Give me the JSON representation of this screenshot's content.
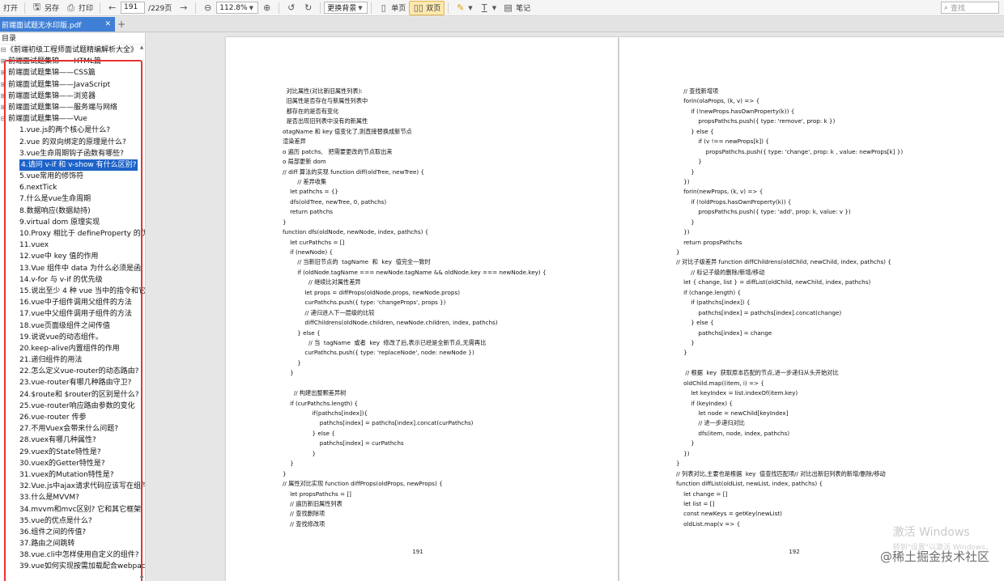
{
  "toolbar": {
    "open": "打开",
    "save_as": "另存",
    "print": "打印",
    "page_input": "191",
    "page_total": "/229页",
    "zoom": "112.8%",
    "background": "更换背景",
    "single": "单页",
    "double": "双页",
    "note": "笔记",
    "search_placeholder": "查找"
  },
  "tab": {
    "title": "前端面试题无水印版.pdf"
  },
  "sidebar": {
    "header": "目录",
    "root": "《前端初级工程师面试题精编解析大全》",
    "sections": [
      "前端面试题集锦——HTML篇",
      "前端面试题集锦——CSS篇",
      "前端面试题集锦——JavaScript",
      "前端面试题集锦——浏览器",
      "前端面试题集锦——服务端与网络",
      "前端面试题集锦——Vue"
    ],
    "items": [
      "1.vue.js的两个核心是什么?",
      "2.vue 的双向绑定的原理是什么?",
      "3.vue生命周期钩子函数有哪些?",
      "4.请问 v-if 和 v-show 有什么区别?",
      "5.vue常用的修饰符",
      "6.nextTick",
      "7.什么是vue生命周期",
      "8.数据响应(数据劫持)",
      "9.virtual dom 原理实现",
      "10.Proxy 相比于 defineProperty 的优",
      "11.vuex",
      "12.vue中 key 值的作用",
      "13.Vue 组件中 data 为什么必须是函",
      "14.v-for 与 v-if 的优先级",
      "15.说出至少 4 种 vue 当中的指令和它",
      "16.vue中子组件调用父组件的方法",
      "17.vue中父组件调用子组件的方法",
      "18.vue页面级组件之间传值",
      "19.说说vue的动态组件。",
      "20.keep-alive内置组件的作用",
      "21.递归组件的用法",
      "22.怎么定义vue-router的动态路由?",
      "23.vue-router有哪几种路由守卫?",
      "24.$route和 $router的区别是什么?",
      "25.vue-router响应路由参数的变化",
      "26.vue-router 传参",
      "27.不用Vuex会带来什么问题?",
      "28.vuex有哪几种属性?",
      "29.vuex的State特性是?",
      "30.vuex的Getter特性是?",
      "31.vuex的Mutation特性是?",
      "32.Vue.js中ajax请求代码应该写在组件",
      "33.什么是MVVM?",
      "34.mvvm和mvc区别? 它和其它框架",
      "35.vue的优点是什么?",
      "36.组件之间的传值?",
      "37.路由之间跳转",
      "38.vue.cli中怎样使用自定义的组件?",
      "39.vue如何实现按需加载配合webpac"
    ]
  },
  "page_left": {
    "lines": [
      "  对比属性(对比新旧属性列表):",
      "  旧属性是否存在与新属性列表中",
      "  都存在的是否有变化",
      "  是否出现旧列表中没有的新属性",
      "otagName 和 key 值变化了,则直接替换成新节点",
      "渲染差异",
      "o 遍历 patchs,   把需要更改的节点取出来",
      "o 局部更新 dom",
      "// diff 算法的实现 function diff(oldTree, newTree) {",
      "        // 差异收集",
      "    let pathchs = {}",
      "    dfs(oldTree, newTree, 0, pathchs)",
      "    return pathchs",
      "}",
      "function dfs(oldNode, newNode, index, pathchs) {",
      "    let curPathchs = []",
      "    if (newNode) {",
      "        // 当新旧节点的  tagName  和  key  值完全一致时",
      "        if (oldNode.tagName === newNode.tagName && oldNode.key === newNode.key) {",
      "              // 继续比对属性差异",
      "            let props = diffProps(oldNode.props, newNode.props)",
      "            curPathchs.push({ type: 'changeProps', props })",
      "            // 递归进入下一层级的比较",
      "            diffChildrens(oldNode.children, newNode.children, index, pathchs)",
      "        } else {",
      "              // 当  tagName  或者  key  修改了后,表示已经是全新节点,无需再比",
      "            curPathchs.push({ type: 'replaceNode', node: newNode })",
      "        }",
      "    }",
      "",
      "      // 构建出整颗差异树",
      "    if (curPathchs.length) {",
      "                if(pathchs[index]){",
      "                    pathchs[index] = pathchs[index].concat(curPathchs)",
      "                } else {",
      "                    pathchs[index] = curPathchs",
      "                }",
      "    }",
      "}",
      "// 属性对比实现 function diffProps(oldProps, newProps) {",
      "    let propsPathchs = []",
      "    // 遍历新旧属性列表",
      "    // 查找删除项",
      "    // 查找修改项"
    ],
    "page_number": "191"
  },
  "page_right": {
    "lines": [
      "    // 查找新增项",
      "    forin(olaProps, (k, v) => {",
      "        if (!newProps.hasOwnProperty(k)) {",
      "            propsPathchs.push({ type: 'remove', prop: k })",
      "        } else {",
      "            if (v !== newProps[k]) {",
      "                propsPathchs.push({ type: 'change', prop: k , value: newProps[k] })",
      "            }",
      "        }",
      "    })",
      "    forin(newProps, (k, v) => {",
      "        if (!oldProps.hasOwnProperty(k)) {",
      "            propsPathchs.push({ type: 'add', prop: k, value: v })",
      "        }",
      "    })",
      "    return propsPathchs",
      "}",
      "// 对比子级差异 function diffChildrens(oldChild, newChild, index, pathchs) {",
      "        // 标记子级的删除/新增/移动",
      "    let { change, list } = diffList(oldChild, newChild, index, pathchs)",
      "    if (change.length) {",
      "        if (pathchs[index]) {",
      "            pathchs[index] = pathchs[index].concat(change)",
      "        } else {",
      "            pathchs[index] = change",
      "        }",
      "    }",
      "",
      "     // 根据  key  获取原本匹配的节点,进一步递归从头开始对比",
      "    oldChild.map((item, i) => {",
      "        let keyIndex = list.indexOf(item.key)",
      "        if (keyIndex) {",
      "            let node = newChild[keyIndex]",
      "            // 进一步递归对比",
      "            dfs(item, node, index, pathchs)",
      "        }",
      "    })",
      "}",
      "// 列表对比,主要也是根据  key  值查找匹配项// 对比出新旧列表的新增/删除/移动",
      "function diffList(oldList, newList, index, pathchs) {",
      "    let change = []",
      "    let list = []",
      "    const newKeys = getKey(newList)",
      "    oldList.map(v => {"
    ],
    "page_number": "192"
  },
  "watermark": {
    "title": "激活 Windows",
    "subtitle": "转到\"设置\"以激活 Windows。"
  },
  "brand": "@稀土掘金技术社区"
}
